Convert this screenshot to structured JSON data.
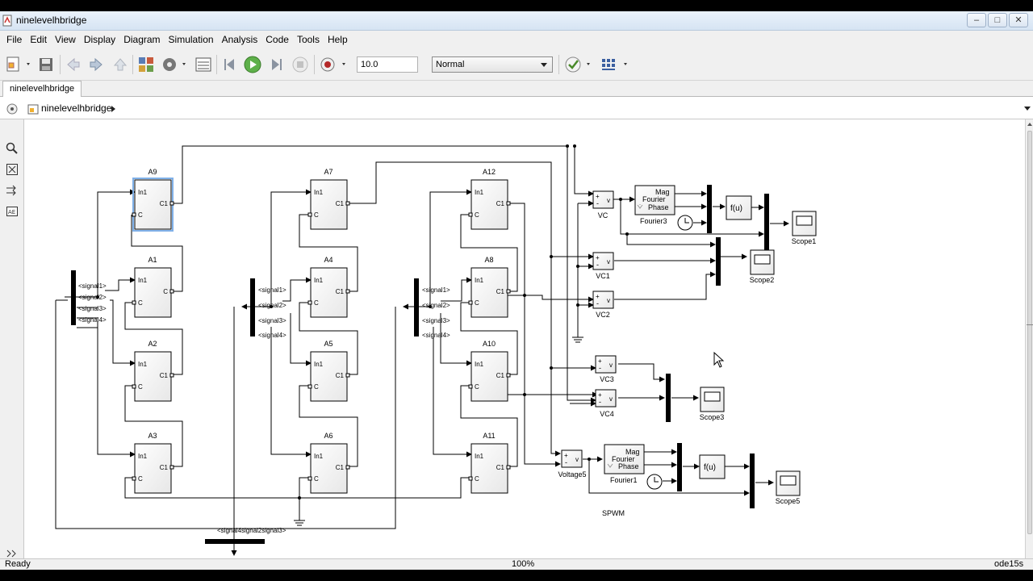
{
  "window": {
    "title": "ninelevelhbridge",
    "buttons": [
      "–",
      "□",
      "✕"
    ]
  },
  "menu": [
    "File",
    "Edit",
    "View",
    "Display",
    "Diagram",
    "Simulation",
    "Analysis",
    "Code",
    "Tools",
    "Help"
  ],
  "toolbar": {
    "stop_time": "10.0",
    "sim_mode": "Normal",
    "icons": [
      "new-model-icon",
      "save-icon",
      "back-icon",
      "forward-icon",
      "up-icon",
      "library-browser-icon",
      "settings-gear-icon",
      "model-explorer-icon",
      "step-back-icon",
      "run-icon",
      "step-forward-icon",
      "stop-icon",
      "record-icon",
      "check-icon",
      "build-icon"
    ]
  },
  "tab": {
    "label": "ninelevelhbridge"
  },
  "breadcrumb": {
    "label": "ninelevelhbridge"
  },
  "status": {
    "left": "Ready",
    "zoom": "100%",
    "solver": "ode15s"
  },
  "diagram": {
    "subsystems": [
      {
        "name": "A9",
        "in1": "In1",
        "c": "C",
        "c1": "C1"
      },
      {
        "name": "A1",
        "in1": "In1",
        "c": "C",
        "c1": "C"
      },
      {
        "name": "A2",
        "in1": "In1",
        "c": "C",
        "c1": "C1"
      },
      {
        "name": "A3",
        "in1": "In1",
        "c": "C",
        "c1": "C1"
      },
      {
        "name": "A7",
        "in1": "In1",
        "c": "C",
        "c1": "C1"
      },
      {
        "name": "A4",
        "in1": "In1",
        "c": "C",
        "c1": "C1"
      },
      {
        "name": "A5",
        "in1": "In1",
        "c": "C",
        "c1": "C1"
      },
      {
        "name": "A6",
        "in1": "In1",
        "c": "C",
        "c1": "C1"
      },
      {
        "name": "A12",
        "in1": "In1",
        "c": "C",
        "c1": "C1"
      },
      {
        "name": "A8",
        "in1": "In1",
        "c": "C",
        "c1": "C1"
      },
      {
        "name": "A10",
        "in1": "In1",
        "c": "C",
        "c1": "C1"
      },
      {
        "name": "A11",
        "in1": "In1",
        "c": "C",
        "c1": "C1"
      }
    ],
    "signals": [
      "<signal1>",
      "<signal2>",
      "<signal3>",
      "<signal4>"
    ],
    "bottom_signals": "<signal4signal2signal3>",
    "voltmeters": [
      "VC",
      "VC1",
      "VC2",
      "VC3",
      "VC4",
      "Voltage5"
    ],
    "voltmeter_glyph": {
      "plus": "+",
      "minus": "-",
      "v": "v"
    },
    "fourier": [
      {
        "name": "Fourier3",
        "mag": "Mag",
        "label": "Fourier",
        "phase": "Phase"
      },
      {
        "name": "Fourier1",
        "mag": "Mag",
        "label": "Fourier",
        "phase": "Phase"
      }
    ],
    "fcn": "f(u)",
    "scopes": [
      "Scope1",
      "Scope2",
      "Scope3",
      "Scope5"
    ],
    "annotation": "SPWM"
  }
}
